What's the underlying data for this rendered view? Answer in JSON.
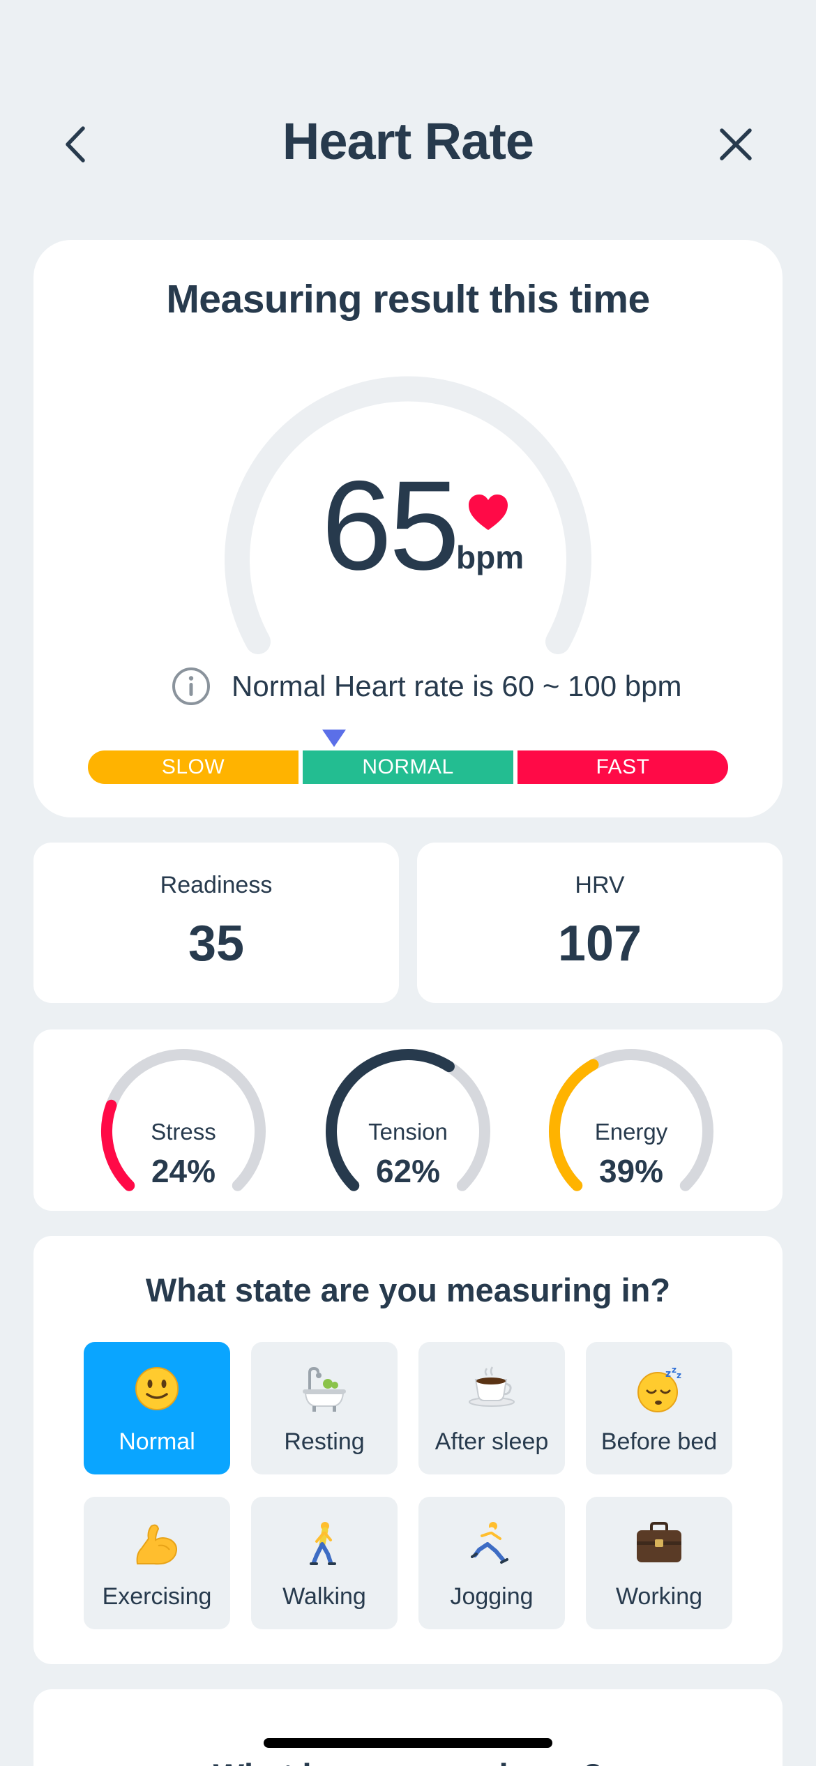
{
  "header": {
    "title": "Heart Rate",
    "back_icon": "chevron-left-icon",
    "close_icon": "close-icon"
  },
  "result": {
    "title": "Measuring result this time",
    "bpm": "65",
    "unit": "bpm",
    "heart_icon": "heart-icon",
    "info_icon": "info-icon",
    "info_text": "Normal Heart rate is 60 ~ 100 bpm",
    "range_segments": [
      {
        "label": "SLOW",
        "color": "#FFB300"
      },
      {
        "label": "NORMAL",
        "color": "#23BD91"
      },
      {
        "label": "FAST",
        "color": "#FF0A47"
      }
    ],
    "pointer_color": "#5B6FE8"
  },
  "stats": {
    "readiness": {
      "label": "Readiness",
      "value": "35"
    },
    "hrv": {
      "label": "HRV",
      "value": "107"
    }
  },
  "meters": [
    {
      "label": "Stress",
      "value": "24%",
      "fraction": 0.24,
      "color": "#FF0A47"
    },
    {
      "label": "Tension",
      "value": "62%",
      "fraction": 0.62,
      "color": "#273A4D"
    },
    {
      "label": "Energy",
      "value": "39%",
      "fraction": 0.39,
      "color": "#FFB300"
    }
  ],
  "state": {
    "title": "What state are you measuring in?",
    "options": [
      {
        "label": "Normal",
        "icon": "slightly-smiling-face-icon",
        "selected": true
      },
      {
        "label": "Resting",
        "icon": "bathtub-icon",
        "selected": false
      },
      {
        "label": "After sleep",
        "icon": "coffee-icon",
        "selected": false
      },
      {
        "label": "Before bed",
        "icon": "sleeping-face-icon",
        "selected": false
      },
      {
        "label": "Exercising",
        "icon": "flexed-biceps-icon",
        "selected": false
      },
      {
        "label": "Walking",
        "icon": "person-walking-icon",
        "selected": false
      },
      {
        "label": "Jogging",
        "icon": "person-running-icon",
        "selected": false
      },
      {
        "label": "Working",
        "icon": "briefcase-icon",
        "selected": false
      }
    ]
  },
  "mood": {
    "title": "What is your mood now?"
  },
  "colors": {
    "background": "#ECF0F3",
    "text": "#273A4D",
    "selected": "#0AA5FF",
    "gauge_track": "#ECEFF2",
    "meter_track": "#D6D8DD"
  }
}
